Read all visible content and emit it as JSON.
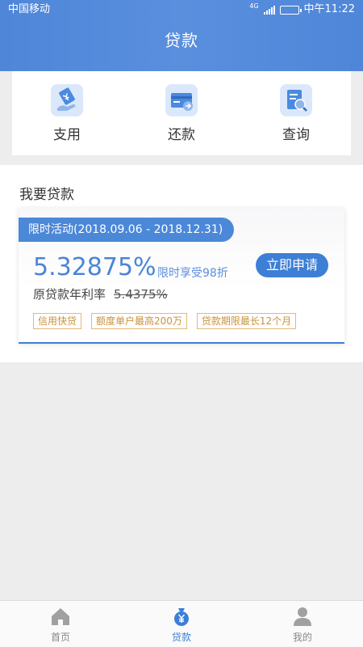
{
  "status_bar": {
    "carrier": "中国移动",
    "network": "4G",
    "time": "中午11:22"
  },
  "header": {
    "title": "贷款"
  },
  "actions": [
    {
      "label": "支用",
      "icon": "withdraw-hand-icon"
    },
    {
      "label": "还款",
      "icon": "repay-card-icon"
    },
    {
      "label": "查询",
      "icon": "query-document-icon"
    }
  ],
  "loan": {
    "section_title": "我要贷款",
    "promo": "限时活动(2018.09.06 - 2018.12.31)",
    "rate": "5.32875%",
    "discount": "限时享受98折",
    "apply_label": "立即申请",
    "original_label": "原贷款年利率",
    "original_rate": "5.4375%",
    "tags": [
      "信用快贷",
      "额度单户最高200万",
      "贷款期限最长12个月"
    ]
  },
  "nav": {
    "items": [
      {
        "label": "首页",
        "icon": "home-icon",
        "active": false
      },
      {
        "label": "贷款",
        "icon": "loan-money-bag-icon",
        "active": true
      },
      {
        "label": "我的",
        "icon": "profile-icon",
        "active": false
      }
    ]
  },
  "colors": {
    "primary": "#4b88d8",
    "accent_tag": "#c9923d",
    "background": "#ededed"
  }
}
